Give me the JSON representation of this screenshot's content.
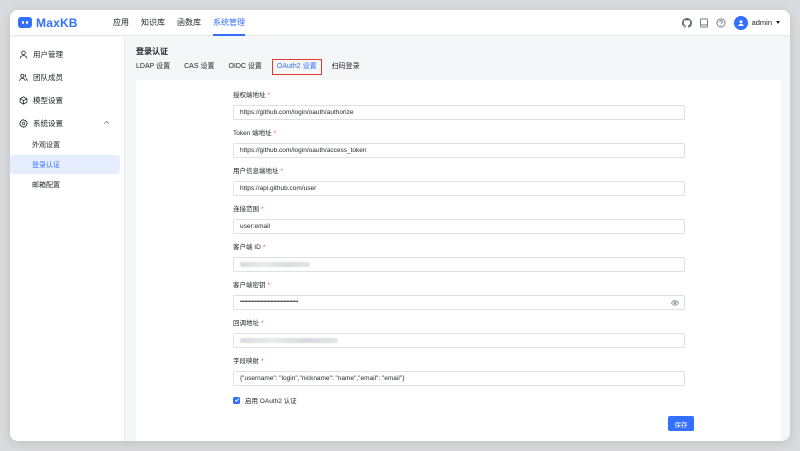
{
  "app": {
    "logo_text": "MaxKB"
  },
  "topnav": {
    "items": [
      {
        "label": "应用"
      },
      {
        "label": "知识库"
      },
      {
        "label": "函数库"
      },
      {
        "label": "系统管理"
      }
    ],
    "active_index": 3
  },
  "user": {
    "name": "admin"
  },
  "sidebar": {
    "items": [
      {
        "label": "用户管理",
        "icon": "user-icon"
      },
      {
        "label": "团队成员",
        "icon": "team-icon"
      },
      {
        "label": "模型设置",
        "icon": "cube-icon"
      },
      {
        "label": "系统设置",
        "icon": "gear-icon",
        "expanded": true
      }
    ],
    "sub_items": [
      {
        "label": "外观设置"
      },
      {
        "label": "登录认证",
        "active": true
      },
      {
        "label": "邮箱配置"
      }
    ]
  },
  "page": {
    "title": "登录认证",
    "tabs": [
      {
        "label": "LDAP 设置"
      },
      {
        "label": "CAS 设置"
      },
      {
        "label": "OIDC 设置"
      },
      {
        "label": "OAuth2 设置",
        "active": true
      },
      {
        "label": "扫码登录"
      }
    ]
  },
  "form": {
    "fields": [
      {
        "label": "授权端地址",
        "required": true,
        "value": "https://github.com/login/oauth/authorize"
      },
      {
        "label": "Token 端地址",
        "required": true,
        "value": "https://github.com/login/oauth/access_token"
      },
      {
        "label": "用户信息端地址",
        "required": true,
        "value": "https://api.github.com/user"
      },
      {
        "label": "连接范围",
        "required": true,
        "value": "user:email"
      },
      {
        "label": "客户端 ID",
        "required": true,
        "value": "",
        "obscured": true
      },
      {
        "label": "客户端密钥",
        "required": true,
        "value": "••••••••••••••••••••••••••••••••••••••••"
      },
      {
        "label": "回调地址",
        "required": true,
        "value": "",
        "obscured": true
      },
      {
        "label": "字段映射",
        "required": true,
        "value": "{\"username\": \"login\",\"nickname\": \"name\",\"email\": \"email\"}"
      }
    ],
    "required_mark": "*",
    "enable_label": "启用 OAuth2 认证",
    "enable_checked": true,
    "save_label": "保存"
  },
  "colors": {
    "accent": "#3370ff",
    "required": "#f54a45",
    "highlight_box": "#e03a31"
  }
}
